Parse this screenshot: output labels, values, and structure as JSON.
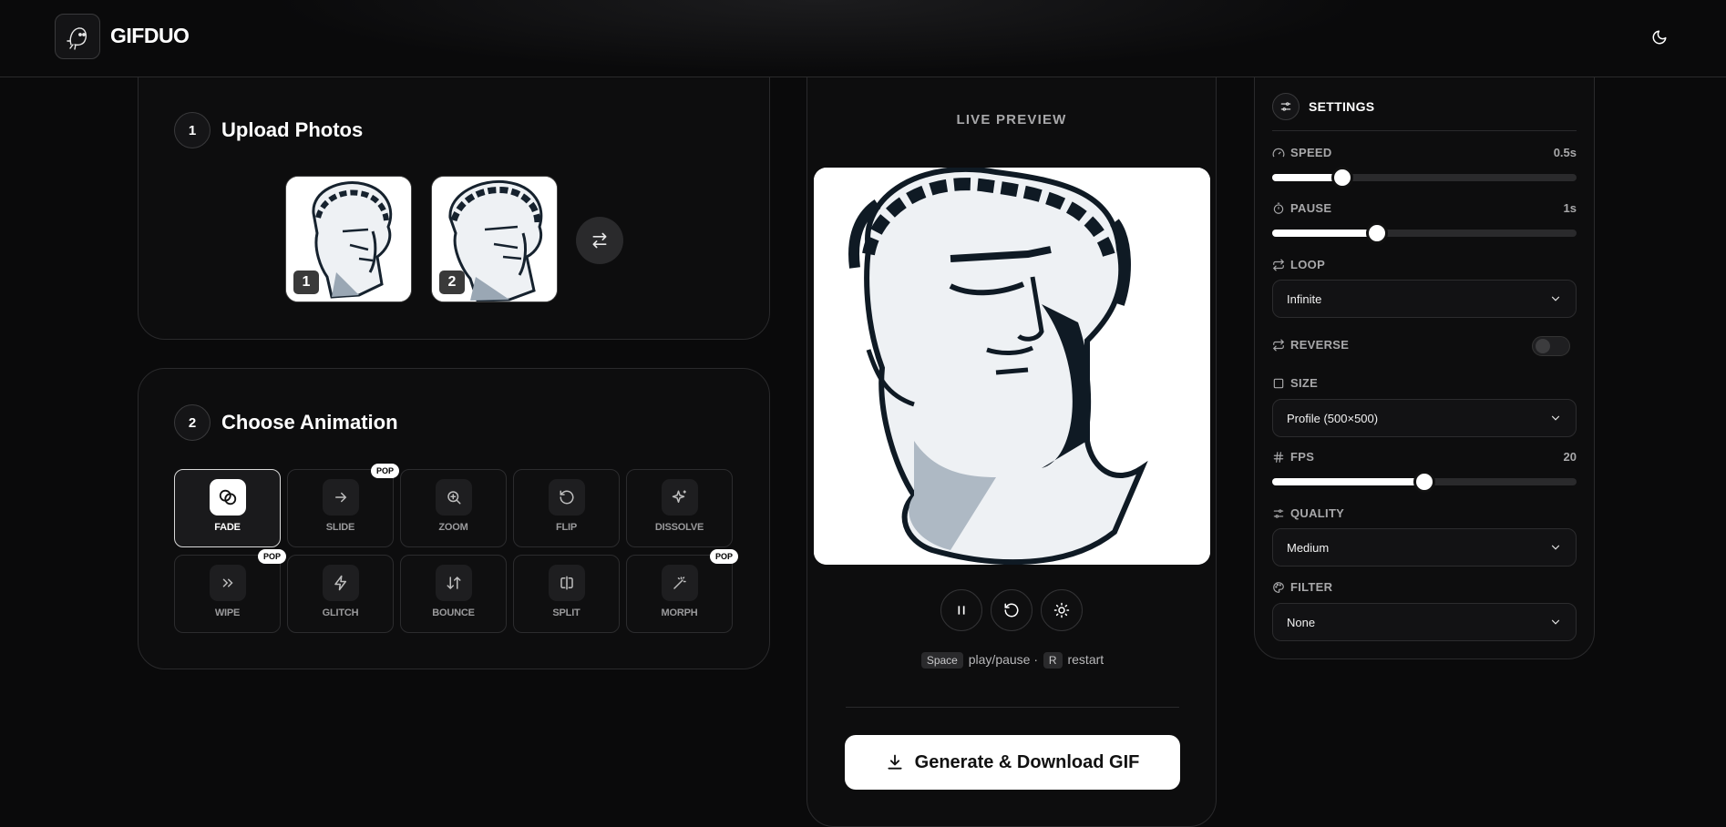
{
  "brand": {
    "name": "GIFDUO"
  },
  "upload": {
    "step": "1",
    "title": "Upload Photos",
    "photos": [
      {
        "badge": "1"
      },
      {
        "badge": "2"
      }
    ]
  },
  "animation": {
    "step": "2",
    "title": "Choose Animation",
    "tiles": [
      {
        "label": "FADE",
        "icon": "fade-icon",
        "active": true,
        "badge": ""
      },
      {
        "label": "SLIDE",
        "icon": "arrow-right-icon",
        "badge": "POP"
      },
      {
        "label": "ZOOM",
        "icon": "zoom-icon",
        "badge": ""
      },
      {
        "label": "FLIP",
        "icon": "rotate-icon",
        "badge": ""
      },
      {
        "label": "DISSOLVE",
        "icon": "sparkles-icon",
        "badge": ""
      },
      {
        "label": "WIPE",
        "icon": "chevrons-right-icon",
        "badge": "POP"
      },
      {
        "label": "GLITCH",
        "icon": "zap-icon",
        "badge": ""
      },
      {
        "label": "BOUNCE",
        "icon": "arrow-up-down-icon",
        "badge": ""
      },
      {
        "label": "SPLIT",
        "icon": "split-icon",
        "badge": ""
      },
      {
        "label": "MORPH",
        "icon": "wand-icon",
        "badge": "POP"
      }
    ]
  },
  "preview": {
    "label": "LIVE PREVIEW",
    "hint": {
      "key1": "Space",
      "text1": "play/pause ·",
      "key2": "R",
      "text2": "restart"
    },
    "generate_label": "Generate & Download GIF"
  },
  "settings": {
    "title": "SETTINGS",
    "speed": {
      "label": "SPEED",
      "value": "0.5s",
      "level": 0.23
    },
    "pause": {
      "label": "PAUSE",
      "value": "1s",
      "level": 0.345
    },
    "loop": {
      "label": "LOOP",
      "value": "Infinite"
    },
    "reverse": {
      "label": "REVERSE",
      "on": false
    },
    "size": {
      "label": "SIZE",
      "value": "Profile (500×500)"
    },
    "fps": {
      "label": "FPS",
      "value": "20",
      "level": 0.5
    },
    "quality": {
      "label": "QUALITY",
      "value": "Medium"
    },
    "filter": {
      "label": "FILTER",
      "value": "None"
    }
  },
  "colors": {
    "background": "#0a0a0b",
    "accent": "#ffffff",
    "card_border": "#2a2a2c"
  }
}
